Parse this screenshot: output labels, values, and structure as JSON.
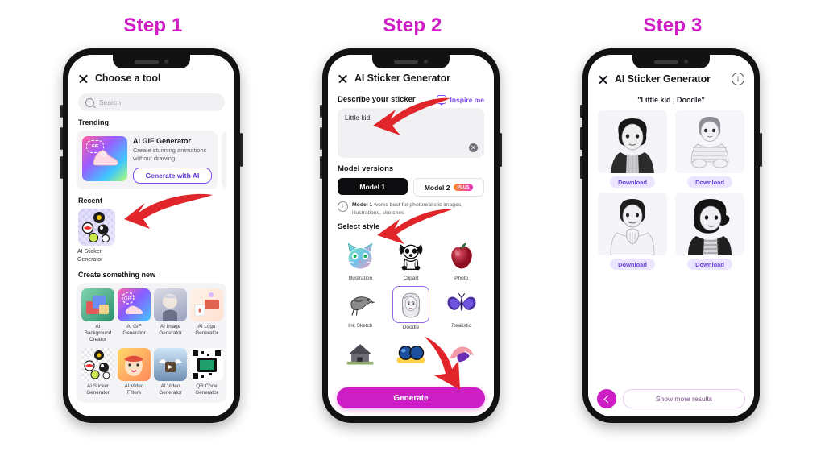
{
  "steps": [
    {
      "label": "Step 1"
    },
    {
      "label": "Step 2"
    },
    {
      "label": "Step 3"
    }
  ],
  "accent": {
    "magenta": "#cf1cc4",
    "purple": "#7b4df0",
    "arrow_red": "#e0262a"
  },
  "phone1": {
    "title": "Choose a tool",
    "close_icon": "close-icon",
    "search": {
      "icon": "search-icon",
      "placeholder": "Search"
    },
    "sections": {
      "trending": "Trending",
      "recent": "Recent",
      "create_new": "Create something new"
    },
    "trending_card": {
      "name": "AI GIF Generator",
      "description": "Create stunning animations without drawing",
      "cta": "Generate with AI",
      "badge": "GIF"
    },
    "recent_item": {
      "label": "AI Sticker Generator"
    },
    "tools": [
      {
        "label": "AI Background Creator"
      },
      {
        "label": "AI GIF Generator"
      },
      {
        "label": "AI Image Generator"
      },
      {
        "label": "AI Logo Generator"
      },
      {
        "label": "AI Sticker Generator"
      },
      {
        "label": "AI Video Filters"
      },
      {
        "label": "AI Video Generator"
      },
      {
        "label": "QR Code Generator"
      }
    ]
  },
  "phone2": {
    "title": "AI Sticker Generator",
    "close_icon": "close-icon",
    "describe_label": "Describe your sticker",
    "inspire_label": "Inspire me",
    "prompt_value": "Little kid",
    "prompt_placeholder": "Describe your sticker",
    "clear_icon": "clear-icon",
    "model_label": "Model versions",
    "models": [
      {
        "label": "Model 1",
        "selected": true,
        "badge": ""
      },
      {
        "label": "Model 2",
        "selected": false,
        "badge": "PLUS"
      }
    ],
    "model_note_bold": "Model 1",
    "model_note": " works best for photorealistic images, illustrations, sketches",
    "style_label": "Select style",
    "styles": [
      {
        "label": "Illustration",
        "selected": false
      },
      {
        "label": "Clipart",
        "selected": false
      },
      {
        "label": "Photo",
        "selected": false
      },
      {
        "label": "Ink Sketch",
        "selected": false
      },
      {
        "label": "Doodle",
        "selected": true
      },
      {
        "label": "Realistic",
        "selected": false
      }
    ],
    "generate_label": "Generate"
  },
  "phone3": {
    "title": "AI Sticker Generator",
    "close_icon": "close-icon",
    "info_icon": "info-icon",
    "prompt_summary": "\"Little kid , Doodle\"",
    "results": [
      {
        "download_label": "Download"
      },
      {
        "download_label": "Download"
      },
      {
        "download_label": "Download"
      },
      {
        "download_label": "Download"
      }
    ],
    "back_icon": "chevron-left-icon",
    "more_label": "Show more results"
  }
}
